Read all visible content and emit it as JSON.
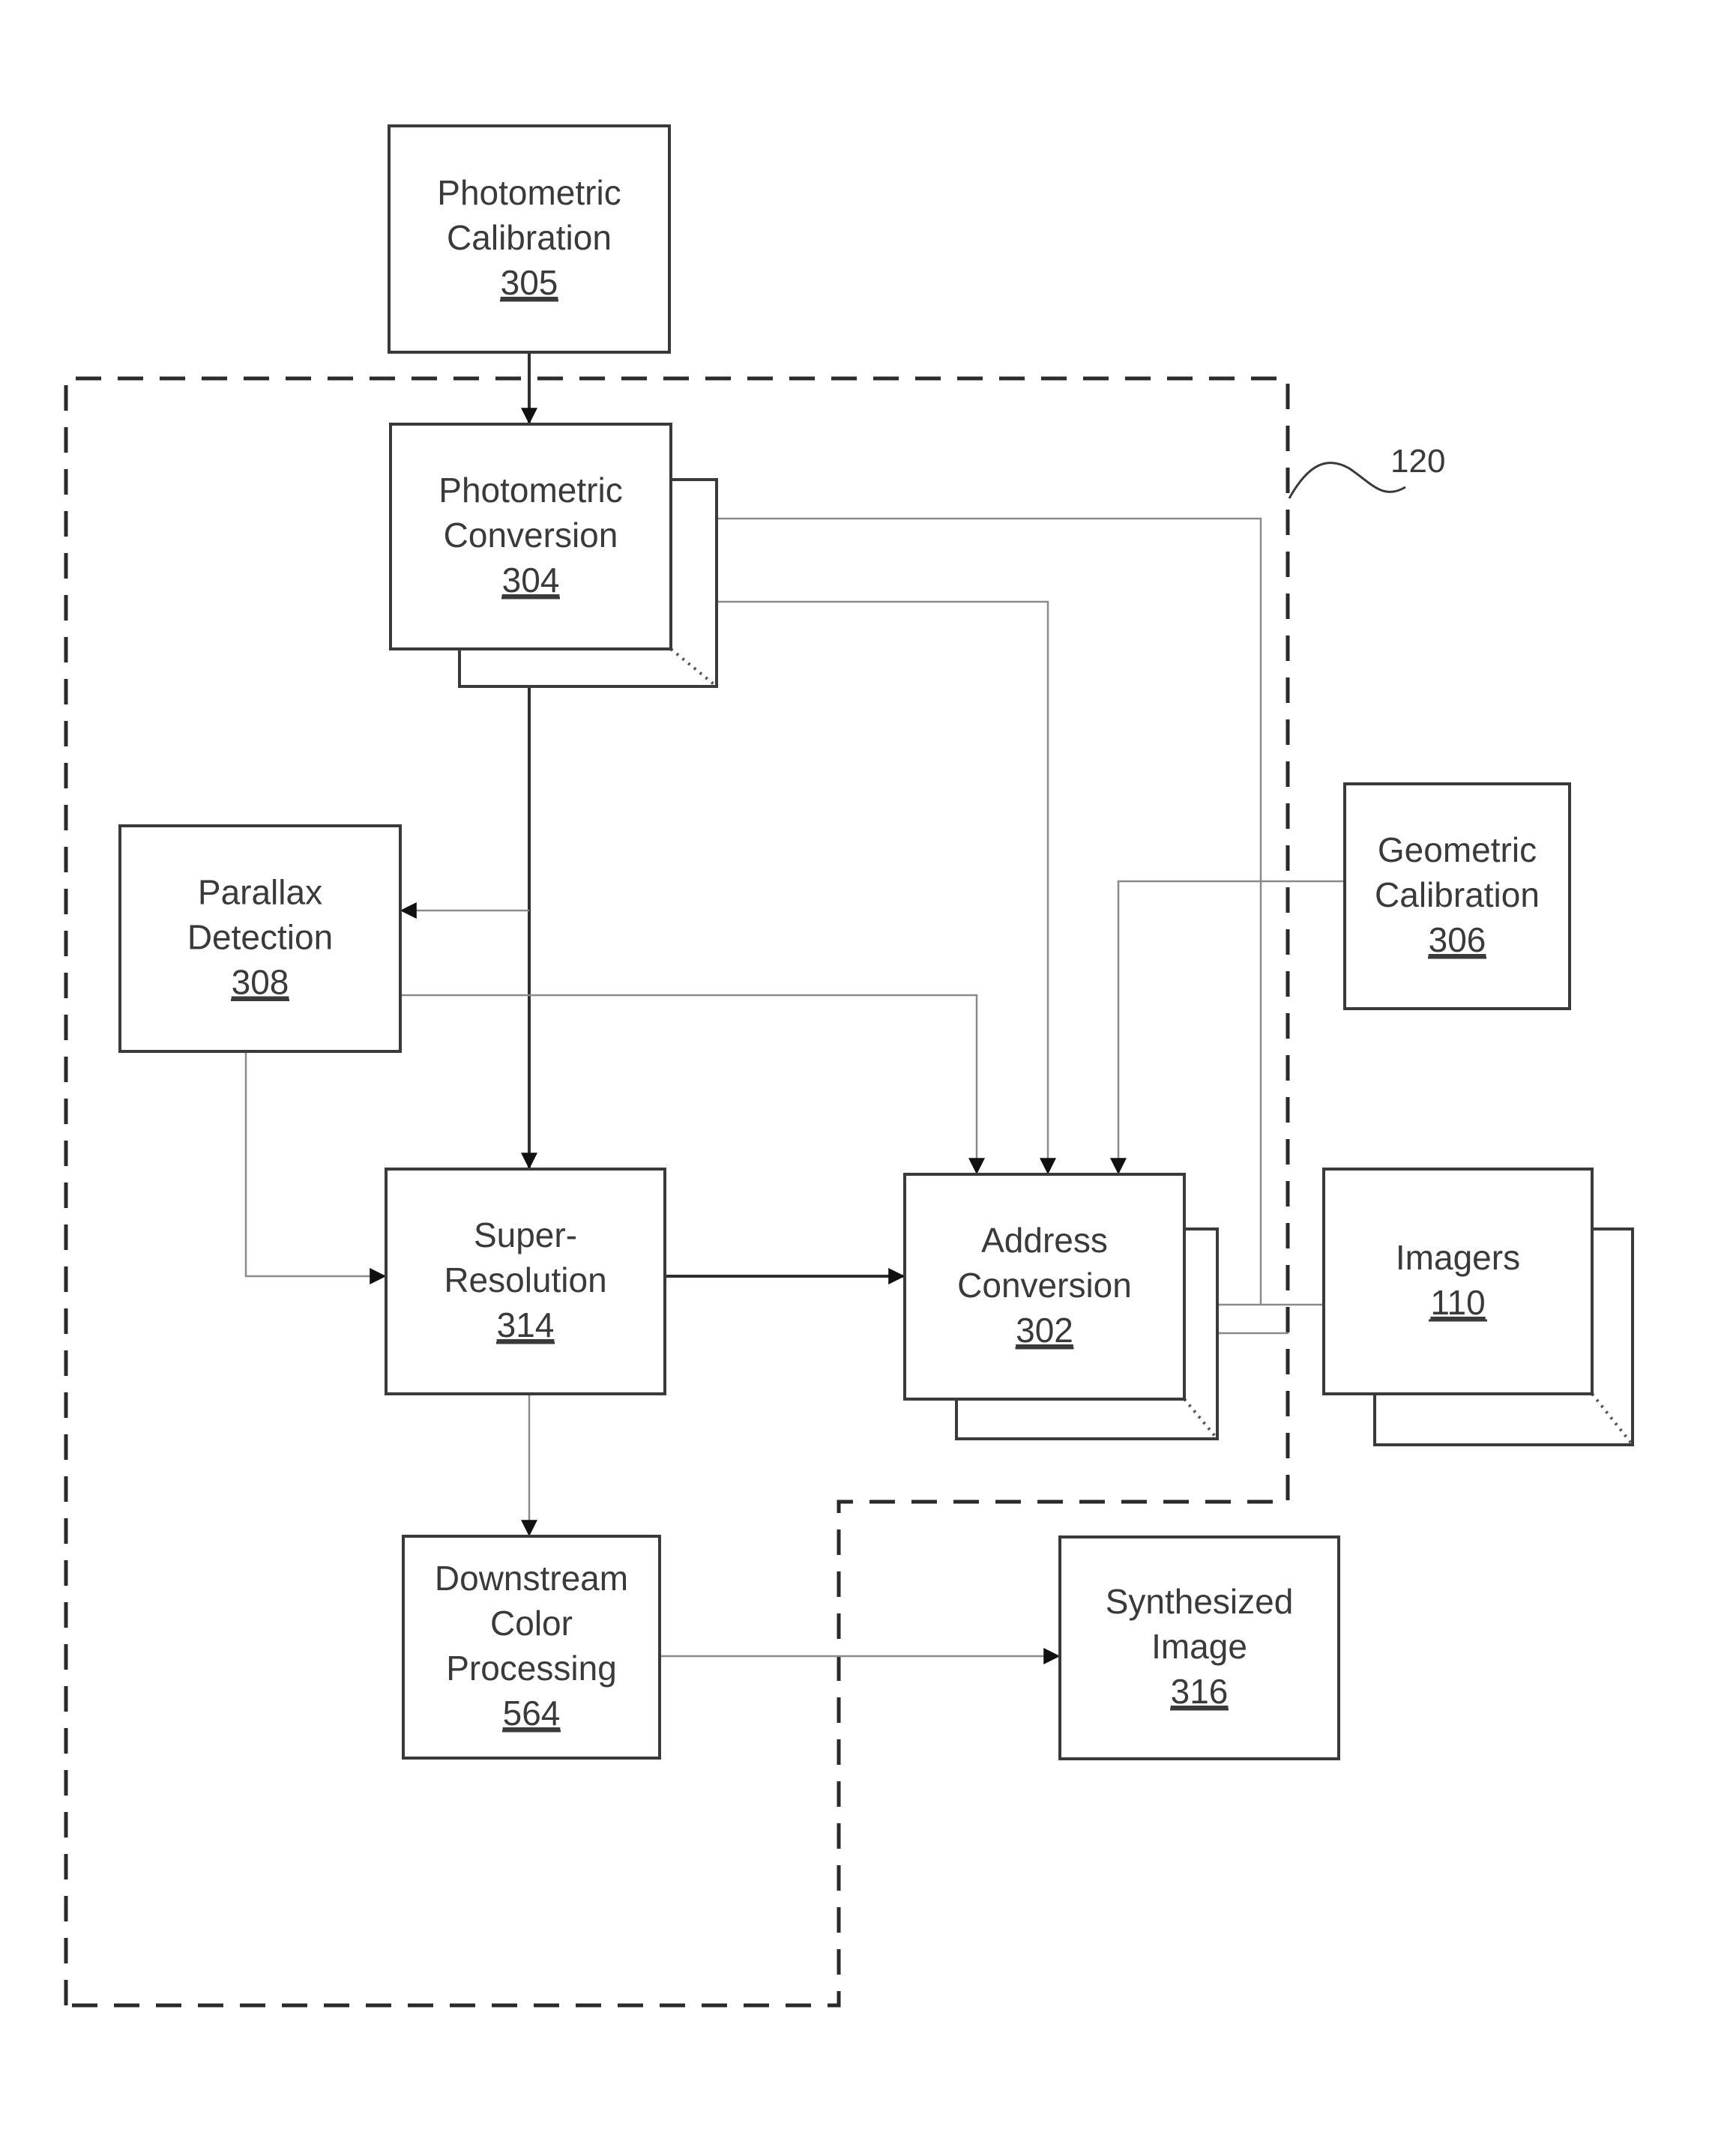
{
  "figure": {
    "system_reference": "120",
    "blocks": [
      {
        "id": "photometric-calibration",
        "lines": [
          "Photometric",
          "Calibration"
        ],
        "ref": "305",
        "stacked": false,
        "inside_boundary": false
      },
      {
        "id": "photometric-conversion",
        "lines": [
          "Photometric",
          "Conversion"
        ],
        "ref": "304",
        "stacked": true,
        "inside_boundary": true
      },
      {
        "id": "parallax-detection",
        "lines": [
          "Parallax",
          "Detection"
        ],
        "ref": "308",
        "stacked": false,
        "inside_boundary": true
      },
      {
        "id": "geometric-calibration",
        "lines": [
          "Geometric",
          "Calibration"
        ],
        "ref": "306",
        "stacked": false,
        "inside_boundary": false
      },
      {
        "id": "super-resolution",
        "lines": [
          "Super-",
          "Resolution"
        ],
        "ref": "314",
        "stacked": false,
        "inside_boundary": true
      },
      {
        "id": "address-conversion",
        "lines": [
          "Address",
          "Conversion"
        ],
        "ref": "302",
        "stacked": true,
        "inside_boundary": true
      },
      {
        "id": "imagers",
        "lines": [
          "Imagers"
        ],
        "ref": "110",
        "stacked": true,
        "inside_boundary": false
      },
      {
        "id": "downstream-color-processing",
        "lines": [
          "Downstream",
          "Color",
          "Processing"
        ],
        "ref": "564",
        "stacked": false,
        "inside_boundary": true
      },
      {
        "id": "synthesized-image",
        "lines": [
          "Synthesized",
          "Image"
        ],
        "ref": "316",
        "stacked": false,
        "inside_boundary": false
      }
    ],
    "connections": [
      {
        "from": "photometric-calibration",
        "to": "photometric-conversion"
      },
      {
        "from": "photometric-conversion",
        "to": "super-resolution"
      },
      {
        "from": "photometric-conversion",
        "to": "parallax-detection"
      },
      {
        "from": "photometric-conversion",
        "to": "address-conversion"
      },
      {
        "from": "parallax-detection",
        "to": "super-resolution"
      },
      {
        "from": "parallax-detection",
        "to": "address-conversion"
      },
      {
        "from": "geometric-calibration",
        "to": "address-conversion"
      },
      {
        "from": "super-resolution",
        "to": "address-conversion"
      },
      {
        "from": "imagers",
        "to": "address-conversion"
      },
      {
        "from": "imagers",
        "to": "photometric-conversion"
      },
      {
        "from": "super-resolution",
        "to": "downstream-color-processing"
      },
      {
        "from": "downstream-color-processing",
        "to": "synthesized-image"
      }
    ]
  }
}
